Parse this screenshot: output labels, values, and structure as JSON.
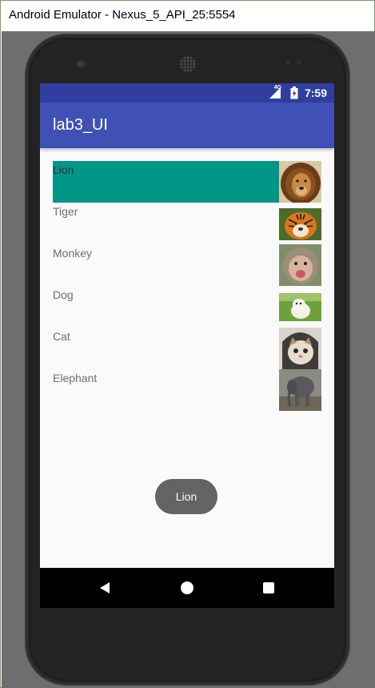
{
  "window": {
    "title": "Android Emulator - Nexus_5_API_25:5554"
  },
  "status_bar": {
    "network": "4G",
    "time": "7:59"
  },
  "app_bar": {
    "title": "lab3_UI"
  },
  "list": {
    "items": [
      {
        "label": "Lion",
        "image": "lion-photo",
        "selected": true
      },
      {
        "label": "Tiger",
        "image": "tiger-photo",
        "selected": false
      },
      {
        "label": "Monkey",
        "image": "monkey-photo",
        "selected": false
      },
      {
        "label": "Dog",
        "image": "dog-photo",
        "selected": false
      },
      {
        "label": "Cat",
        "image": "cat-photo",
        "selected": false
      },
      {
        "label": "Elephant",
        "image": "elephant-photo",
        "selected": false
      }
    ]
  },
  "toast": {
    "text": "Lion"
  },
  "nav_bar": {
    "buttons": [
      "back-icon",
      "home-icon",
      "recent-apps-icon"
    ]
  },
  "colors": {
    "status_bar": "#303f9f",
    "app_bar": "#3f51b5",
    "selected_row": "#009688",
    "toast": "#646464"
  }
}
